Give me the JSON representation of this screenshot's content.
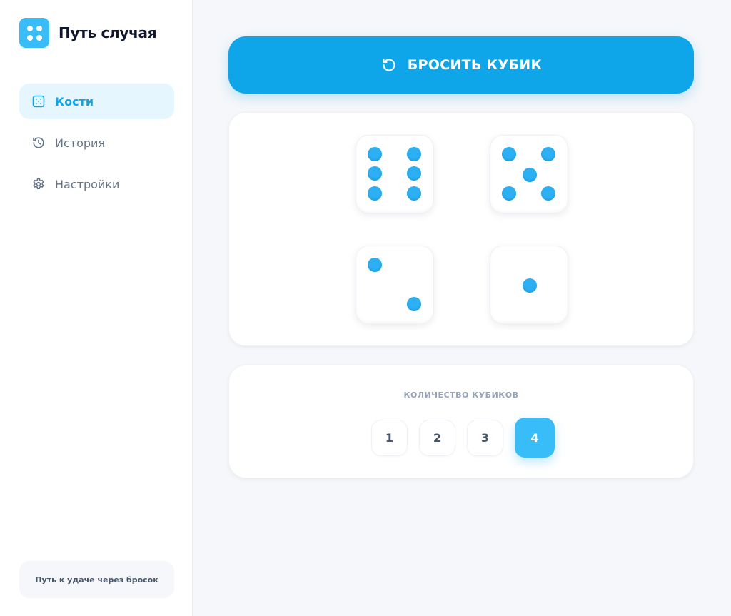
{
  "app": {
    "name": "Путь случая"
  },
  "sidebar": {
    "items": [
      {
        "label": "Кости",
        "icon": "dice-icon",
        "active": true
      },
      {
        "label": "История",
        "icon": "history-icon",
        "active": false
      },
      {
        "label": "Настройки",
        "icon": "gear-icon",
        "active": false
      }
    ],
    "footer": "Путь к удаче через бросок"
  },
  "roll_button": {
    "label": "БРОСИТЬ КУБИК",
    "icon": "refresh-icon"
  },
  "dice": {
    "values": [
      6,
      5,
      2,
      1
    ]
  },
  "dice_count": {
    "title": "КОЛИЧЕСТВО КУБИКОВ",
    "options": [
      "1",
      "2",
      "3",
      "4"
    ],
    "selected": "4"
  },
  "colors": {
    "accent": "#0ea5e9",
    "accent_light": "#38bdf8",
    "pip": "#2cb0f3",
    "active_bg": "#e6f6fe"
  }
}
